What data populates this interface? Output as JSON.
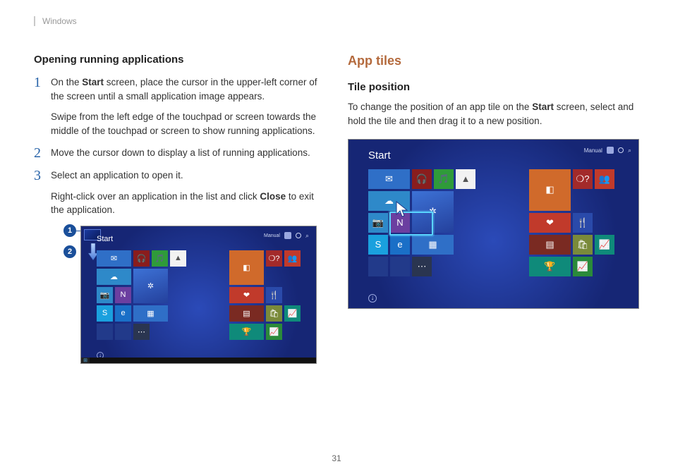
{
  "header": {
    "chapter": "Windows"
  },
  "left": {
    "heading": "Opening running applications",
    "steps": {
      "s1": {
        "num": "1",
        "p1a": "On the ",
        "p1b": "Start",
        "p1c": " screen, place the cursor in the upper-left corner of the screen until a small application image appears.",
        "p2": "Swipe from the left edge of the touchpad or screen towards the middle of the touchpad or screen to show running applications."
      },
      "s2": {
        "num": "2",
        "text": "Move the cursor down to display a list of running applications."
      },
      "s3": {
        "num": "3",
        "p1": "Select an application to open it.",
        "p2a": "Right-click over an application in the list and click ",
        "p2b": "Close",
        "p2c": " to exit the application."
      }
    },
    "callouts": {
      "c1": "1",
      "c2": "2"
    },
    "start": {
      "title": "Start",
      "user": "Manual"
    }
  },
  "right": {
    "section_heading": "App tiles",
    "subheading": "Tile position",
    "para_a": "To change the position of an app tile on the ",
    "para_b": "Start",
    "para_c": " screen, select and hold the tile and then drag it to a new position.",
    "start": {
      "title": "Start",
      "user": "Manual"
    }
  },
  "page_number": "31",
  "tiles": {
    "icons": {
      "mail": "✉",
      "headset": "🎧",
      "music": "🎵",
      "cloud": "☁",
      "onedrive": "▲",
      "sun": "✲",
      "note": "N",
      "skype": "S",
      "ie": "e",
      "calendar": "▦",
      "store": "🛍",
      "help": "❍?",
      "people": "👥",
      "office": "◧",
      "heart": "❤",
      "cutlery": "🍴",
      "trophy": "🏆",
      "chart": "📈",
      "camera": "📷",
      "dots": "⋯",
      "news": "▤"
    }
  }
}
